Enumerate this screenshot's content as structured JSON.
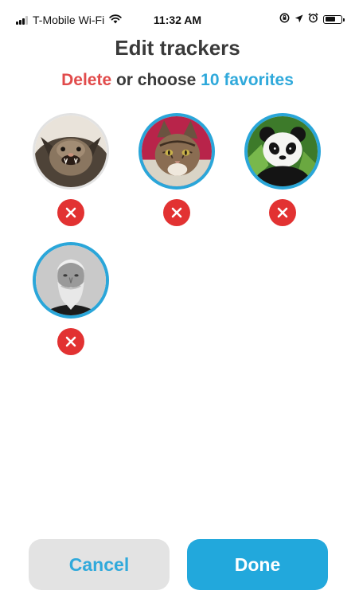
{
  "status_bar": {
    "carrier": "T-Mobile Wi-Fi",
    "time": "11:32 AM",
    "battery_level": 0.7
  },
  "header": {
    "title": "Edit trackers",
    "subtitle_delete": "Delete",
    "subtitle_middle": " or choose ",
    "subtitle_favorites": "10 favorites"
  },
  "trackers": [
    {
      "subject": "bat",
      "favorite": false
    },
    {
      "subject": "cat",
      "favorite": true
    },
    {
      "subject": "panda",
      "favorite": true
    },
    {
      "subject": "bearded-man-portrait",
      "favorite": true
    }
  ],
  "buttons": {
    "cancel_label": "Cancel",
    "done_label": "Done"
  },
  "colors": {
    "accent_blue": "#22a8dc",
    "delete_red": "#e23232",
    "title_text": "#3a3a3a"
  }
}
